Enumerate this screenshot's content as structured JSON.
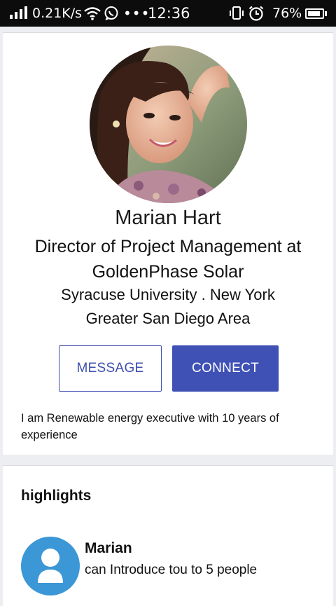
{
  "status_bar": {
    "speed": "0.21K/s",
    "time": "12:36",
    "battery_percent": "76%",
    "battery_level": 0.76,
    "icons": [
      "signal-icon",
      "wifi-icon",
      "whatsapp-icon",
      "more-dots-icon",
      "vibrate-icon",
      "alarm-icon",
      "battery-icon"
    ]
  },
  "profile": {
    "name": "Marian Hart",
    "title": "Director of Project Management at GoldenPhase Solar",
    "school": "Syracuse University . New York",
    "location": "Greater San Diego Area",
    "about": "I am Renewable energy executive with 10 years of experience"
  },
  "actions": {
    "message_label": "MESSAGE",
    "connect_label": "CONNECT"
  },
  "highlights": {
    "heading": "highlights",
    "items": [
      {
        "name": "Marian",
        "description": "can Introduce tou to 5 people"
      }
    ]
  },
  "colors": {
    "accent": "#3f51b5",
    "avatar_bg": "#3b97d6",
    "status_bar": "#0c0c0c",
    "page_bg": "#eceef1"
  }
}
